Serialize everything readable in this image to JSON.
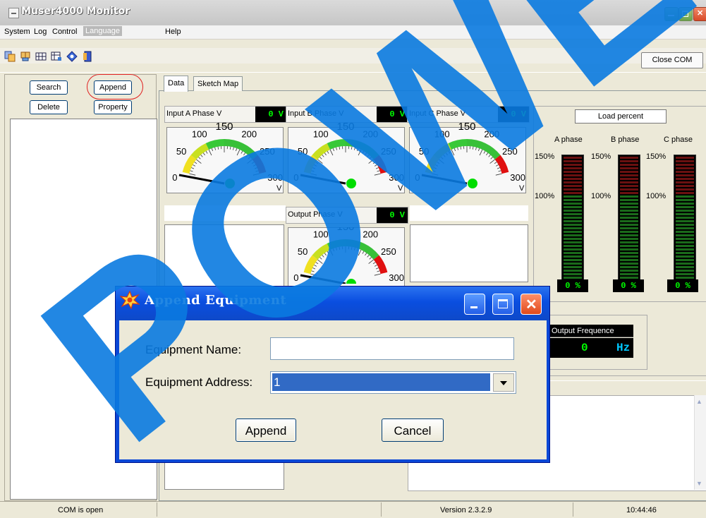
{
  "window": {
    "title": "Muser4000 Monitor"
  },
  "menu": {
    "items": [
      "System",
      "Log",
      "Control",
      "Language",
      "Help"
    ]
  },
  "toolbar": {
    "icons": [
      "copy-icon",
      "network-icon",
      "grid-icon",
      "table-icon",
      "diamond-icon",
      "exit-door-icon"
    ],
    "close_com_label": "Close COM"
  },
  "left_panel": {
    "search_label": "Search",
    "append_label": "Append",
    "delete_label": "Delete",
    "property_label": "Property"
  },
  "tabs": {
    "data": "Data",
    "sketch_map": "Sketch Map"
  },
  "gauges": {
    "input_a": {
      "label": "Input A Phase V",
      "value": "0 V"
    },
    "input_b": {
      "label": "Input B Phase V",
      "value": "0 V"
    },
    "input_c": {
      "label": "Input C Phase V",
      "value": "0 V"
    },
    "output": {
      "label": "Output Phase V",
      "value": "0 V"
    },
    "scale": {
      "t0": "0",
      "t50": "50",
      "t100": "100",
      "t150": "150",
      "t200": "200",
      "t250": "250",
      "t300": "300",
      "unit": "V"
    }
  },
  "load": {
    "title": "Load percent",
    "phase_a": "A phase",
    "phase_b": "B phase",
    "phase_c": "C phase",
    "p150": "150%",
    "p100": "100%",
    "value_a": "0 %",
    "value_b": "0 %",
    "value_c": "0 %"
  },
  "frequency": {
    "label": "Output Frequence",
    "value": "0",
    "unit": "Hz"
  },
  "status": {
    "com_status": "COM is open",
    "version": "Version 2.3.2.9",
    "time": "10:44:46"
  },
  "dialog": {
    "title": "Append Equipment",
    "name_label": "Equipment Name:",
    "name_value": "",
    "address_label": "Equipment Address:",
    "address_value": "1",
    "append_label": "Append",
    "cancel_label": "Cancel"
  },
  "watermark_text": "POWER"
}
